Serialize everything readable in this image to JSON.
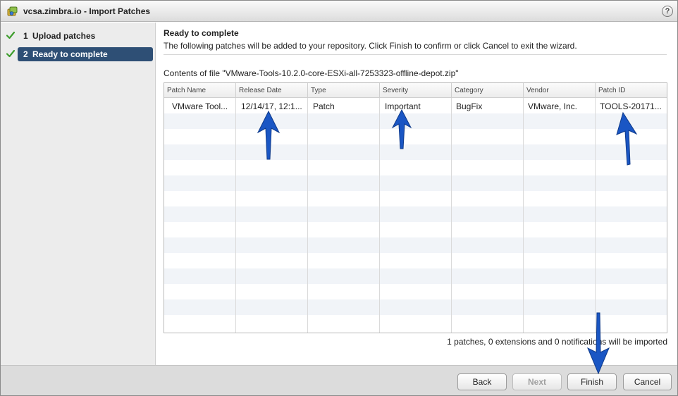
{
  "window": {
    "title": "vcsa.zimbra.io - Import Patches",
    "title_icon": "vsphere-patch-icon",
    "help_label": "?"
  },
  "sidebar": {
    "steps": [
      {
        "number": "1",
        "label": "Upload patches",
        "completed": true,
        "active": false
      },
      {
        "number": "2",
        "label": "Ready to complete",
        "completed": true,
        "active": true
      }
    ]
  },
  "main": {
    "heading": "Ready to complete",
    "subheading": "The following patches will be added to your repository. Click Finish to confirm or click Cancel to exit the wizard.",
    "file_line": "Contents of file \"VMware-Tools-10.2.0-core-ESXi-all-7253323-offline-depot.zip\"",
    "table": {
      "columns": [
        "Patch Name",
        "Release Date",
        "Type",
        "Severity",
        "Category",
        "Vendor",
        "Patch ID"
      ],
      "rows": [
        [
          "VMware Tool...",
          "12/14/17, 12:1...",
          "Patch",
          "Important",
          "BugFix",
          "VMware, Inc.",
          "TOOLS-20171..."
        ]
      ]
    },
    "summary": "1 patches, 0 extensions and 0 notifications will be imported"
  },
  "footer": {
    "back_label": "Back",
    "next_label": "Next",
    "finish_label": "Finish",
    "cancel_label": "Cancel"
  },
  "colors": {
    "active_step": "#2e4f75",
    "check": "#3f9e2e",
    "annotation_arrow": "#1a56c4"
  }
}
